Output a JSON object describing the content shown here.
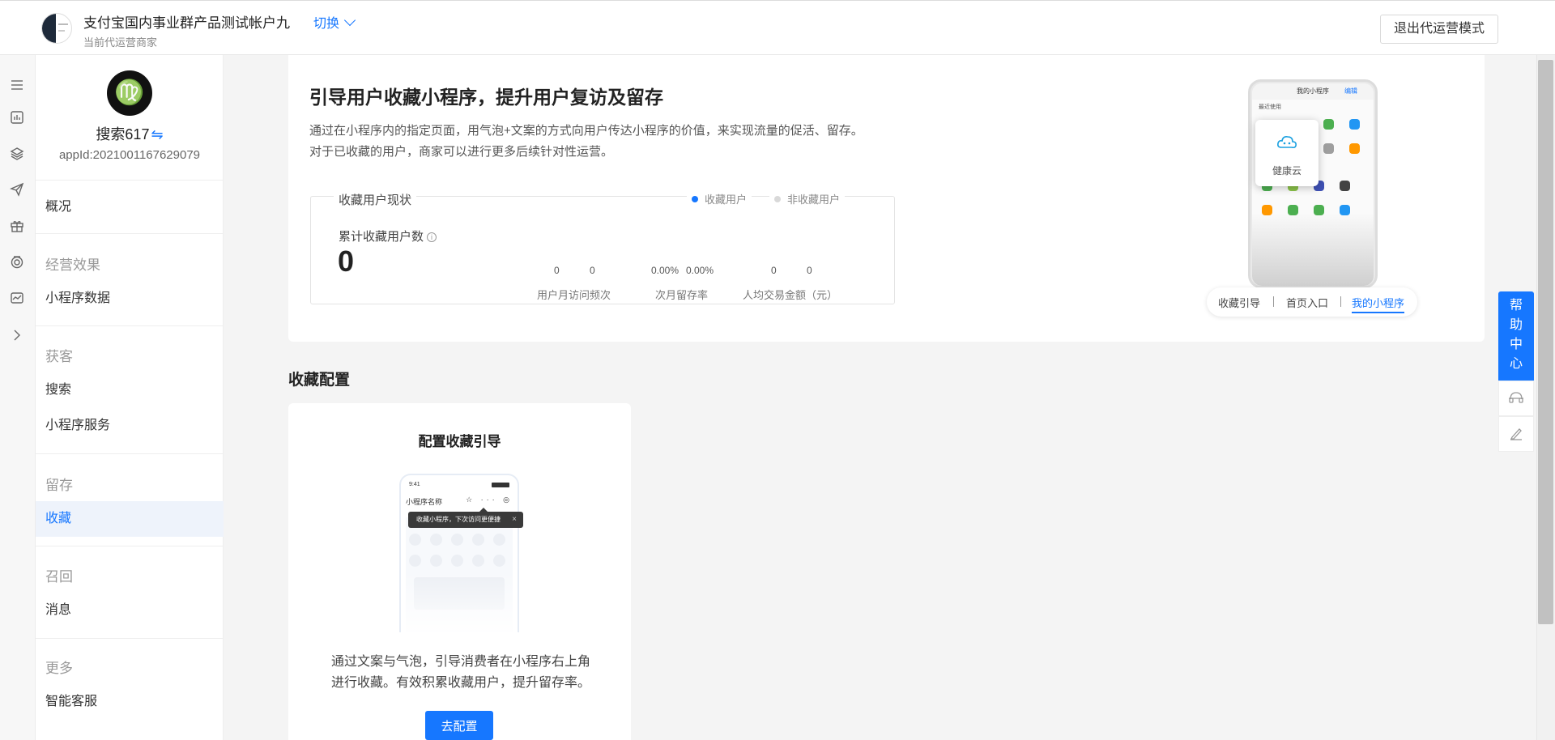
{
  "header": {
    "merchant_name": "支付宝国内事业群产品测试帐户九",
    "switch_label": "切换",
    "merchant_sub": "当前代运营商家",
    "exit_button": "退出代运营模式"
  },
  "rail": {
    "icons": [
      "menu-icon",
      "chart-icon",
      "cube-icon",
      "send-icon",
      "gift-icon",
      "target-icon",
      "store-icon",
      "chevron-right-icon"
    ]
  },
  "app": {
    "name": "搜索617",
    "switch_glyph": "⇋",
    "app_id": "appId:2021001167629079"
  },
  "nav": {
    "overview": "概况",
    "group_effect": "经营效果",
    "mini_data": "小程序数据",
    "group_acquire": "获客",
    "search": "搜索",
    "mini_service": "小程序服务",
    "group_retain": "留存",
    "favorite": "收藏",
    "group_recall": "召回",
    "message": "消息",
    "group_more": "更多",
    "smart_service": "智能客服"
  },
  "hero": {
    "title": "引导用户收藏小程序，提升用户复访及留存",
    "desc_line1": "通过在小程序内的指定页面，用气泡+文案的方式向用户传达小程序的价值，来实现流量的促活、留存。",
    "desc_line2": "对于已收藏的用户，商家可以进行更多后续针对性运营。"
  },
  "stats": {
    "title": "收藏用户现状",
    "legend_fav": "收藏用户",
    "legend_nonfav": "非收藏用户",
    "total_label": "累计收藏用户数",
    "total_value": "0",
    "visit_fav": "0",
    "visit_nonfav": "0",
    "visit_label": "用户月访问频次",
    "retain_fav": "0.00%",
    "retain_nonfav": "0.00%",
    "retain_label": "次月留存率",
    "amount_fav": "0",
    "amount_nonfav": "0",
    "amount_label": "人均交易金额（元）"
  },
  "preview": {
    "screen_title": "我的小程序",
    "edit_label": "编辑",
    "recent_label": "最近使用",
    "popup_label": "健康云",
    "tabs": [
      "收藏引导",
      "首页入口",
      "我的小程序"
    ],
    "active_tab": "我的小程序"
  },
  "config": {
    "section_title": "收藏配置",
    "card_title": "配置收藏引导",
    "phone_time": "9:41",
    "phone_app_name": "小程序名称",
    "phone_actions": "☆ ··· ◎",
    "tooltip_text": "收藏小程序，下次访问更便捷",
    "desc": "通过文案与气泡，引导消费者在小程序右上角进行收藏。有效积累收藏用户，提升留存率。",
    "button": "去配置"
  },
  "help": {
    "chars": [
      "帮",
      "助",
      "中",
      "心"
    ]
  },
  "colors": {
    "primary": "#1677ff",
    "legend_nonfav": "#d9d9d9"
  }
}
